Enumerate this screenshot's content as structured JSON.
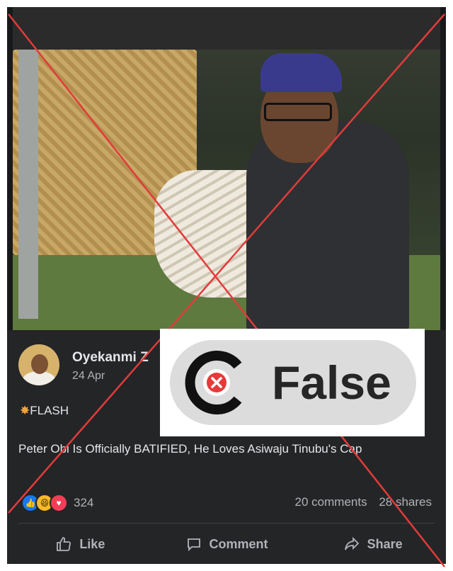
{
  "post": {
    "author": "Oyekanmi Z",
    "date": "24 Apr",
    "flash_label": "FLASH",
    "text": "Peter Obi Is Officially BATIFIED, He Loves Asiwaju Tinubu's Cap",
    "reaction_count": "324",
    "comments": "20 comments",
    "shares": "28 shares",
    "actions": {
      "like": "Like",
      "comment": "Comment",
      "share": "Share"
    }
  },
  "verdict": {
    "label": "False",
    "color": "#e63a3a"
  },
  "colors": {
    "cross_line": "#e23b3b",
    "background": "#242526"
  }
}
